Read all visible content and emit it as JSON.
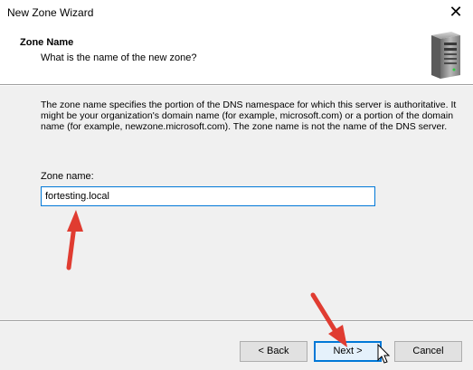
{
  "window": {
    "title": "New Zone Wizard",
    "close_glyph": "✕"
  },
  "header": {
    "title": "Zone Name",
    "subtitle": "What is the name of the new zone?",
    "icon": "server-icon"
  },
  "body": {
    "description": "The zone name specifies the portion of the DNS namespace for which this server is authoritative. It might be your organization's domain name (for example,  microsoft.com) or a portion of the domain name (for example, newzone.microsoft.com). The zone name is not the name of the DNS server.",
    "zone_name_label": "Zone name:",
    "zone_name_value": "fortesting.local"
  },
  "buttons": {
    "back": "< Back",
    "next": "Next >",
    "cancel": "Cancel"
  },
  "annotations": {
    "arrow_color": "#e03c31"
  }
}
